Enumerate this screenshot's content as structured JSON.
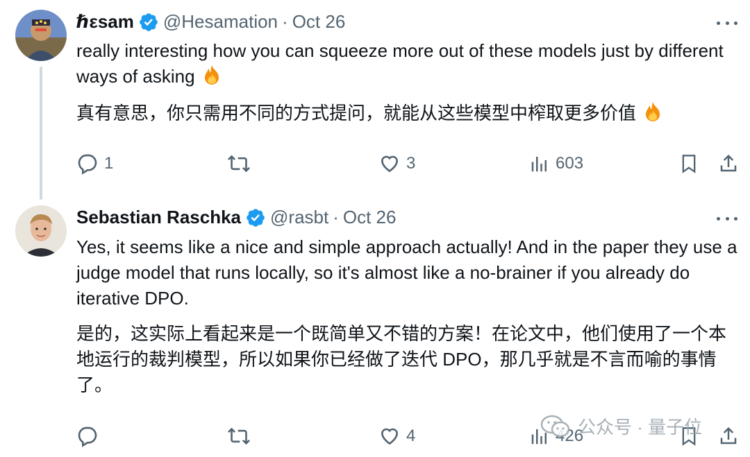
{
  "tweets": [
    {
      "name": "ℏεsam",
      "handle": "@Hesamation",
      "separator": "·",
      "date": "Oct 26",
      "text_en": "really interesting how you  can squeeze more out of these models just by different ways of asking",
      "text_zh": "真有意思，你只需用不同的方式提问，就能从这些模型中榨取更多价值",
      "emoji": "fire-emoji",
      "replies": "1",
      "retweets": "",
      "likes": "3",
      "views": "603"
    },
    {
      "name": "Sebastian Raschka",
      "handle": "@rasbt",
      "separator": "·",
      "date": "Oct 26",
      "text_en": "Yes, it seems like a nice and simple approach actually! And in the paper they use a judge model that runs locally, so it's almost like a no-brainer if you already do iterative DPO.",
      "text_zh": "是的，这实际上看起来是一个既简单又不错的方案！在论文中，他们使用了一个本地运行的裁判模型，所以如果你已经做了迭代 DPO，那几乎就是不言而喻的事情了。",
      "replies": "",
      "retweets": "",
      "likes": "4",
      "views": "426"
    }
  ],
  "watermark": {
    "text": "公众号 · 量子位"
  },
  "colors": {
    "text": "#0f1419",
    "muted": "#536471",
    "verified": "#1d9bf0",
    "thread_line": "#cfd9de"
  }
}
